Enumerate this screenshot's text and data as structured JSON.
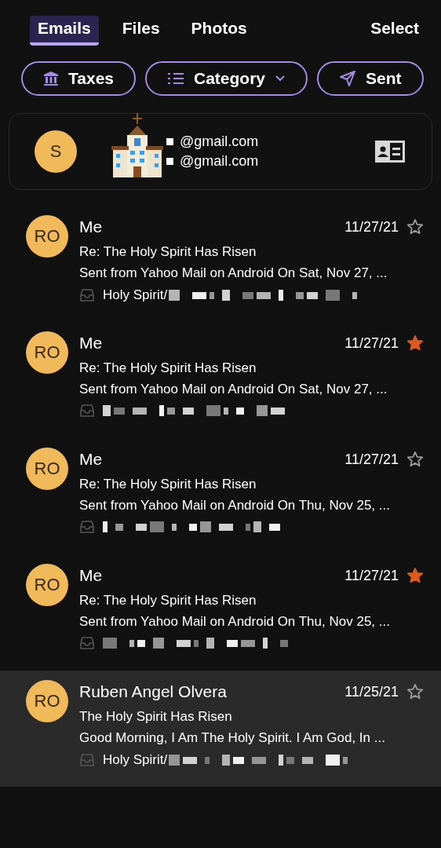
{
  "tabs": [
    {
      "label": "Emails",
      "selected": true
    },
    {
      "label": "Files",
      "selected": false
    },
    {
      "label": "Photos",
      "selected": false
    }
  ],
  "select_button": "Select",
  "filters": [
    {
      "kind": "taxes",
      "label": "Taxes"
    },
    {
      "kind": "category",
      "label": "Category"
    },
    {
      "kind": "sent",
      "label": "Sent"
    }
  ],
  "contact": {
    "initial": "S",
    "emails": [
      "@gmail.com",
      "@gmail.com"
    ]
  },
  "emails": [
    {
      "initials": "RO",
      "sender": "Me",
      "date": "11/27/21",
      "starred": false,
      "selected": false,
      "subject": "Re: The Holy Spirit Has Risen",
      "preview": "Sent from Yahoo Mail on Android On Sat, Nov 27, ...",
      "folder": "Holy Spirit/"
    },
    {
      "initials": "RO",
      "sender": "Me",
      "date": "11/27/21",
      "starred": true,
      "selected": false,
      "subject": "Re: The Holy Spirit Has Risen",
      "preview": "Sent from Yahoo Mail on Android On Sat, Nov 27, ..."
    },
    {
      "initials": "RO",
      "sender": "Me",
      "date": "11/27/21",
      "starred": false,
      "selected": false,
      "subject": "Re: The Holy Spirit Has Risen",
      "preview": "Sent from Yahoo Mail on Android On Thu, Nov 25, ..."
    },
    {
      "initials": "RO",
      "sender": "Me",
      "date": "11/27/21",
      "starred": true,
      "selected": false,
      "subject": "Re: The Holy Spirit Has Risen",
      "preview": "Sent from Yahoo Mail on Android On Thu, Nov 25, ..."
    },
    {
      "initials": "RO",
      "sender": "Ruben Angel Olvera",
      "date": "11/25/21",
      "starred": false,
      "selected": true,
      "subject": "The Holy Spirit Has Risen",
      "preview": "Good Morning, I Am The Holy Spirit. I Am God, In ...",
      "folder": "Holy Spirit/"
    }
  ]
}
